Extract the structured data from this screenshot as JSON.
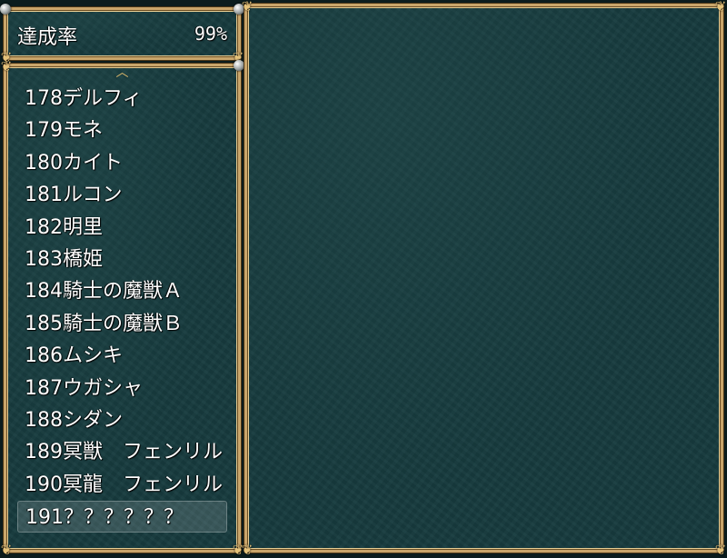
{
  "completion": {
    "label": "達成率",
    "value": "99%"
  },
  "list": {
    "items": [
      {
        "label": "178デルフィ"
      },
      {
        "label": "179モネ"
      },
      {
        "label": "180カイト"
      },
      {
        "label": "181ルコン"
      },
      {
        "label": "182明里"
      },
      {
        "label": "183橋姫"
      },
      {
        "label": "184騎士の魔獣Ａ"
      },
      {
        "label": "185騎士の魔獣Ｂ"
      },
      {
        "label": "186ムシキ"
      },
      {
        "label": "187ウガシャ"
      },
      {
        "label": "188シダン"
      },
      {
        "label": "189冥獣　フェンリル"
      },
      {
        "label": "190冥龍　フェンリル"
      },
      {
        "label": "191？？？？？？"
      }
    ],
    "selected_index": 13
  },
  "theme": {
    "frame_gold": "#c9a56a",
    "window_teal": "#173b3e",
    "text": "#ffffff"
  }
}
